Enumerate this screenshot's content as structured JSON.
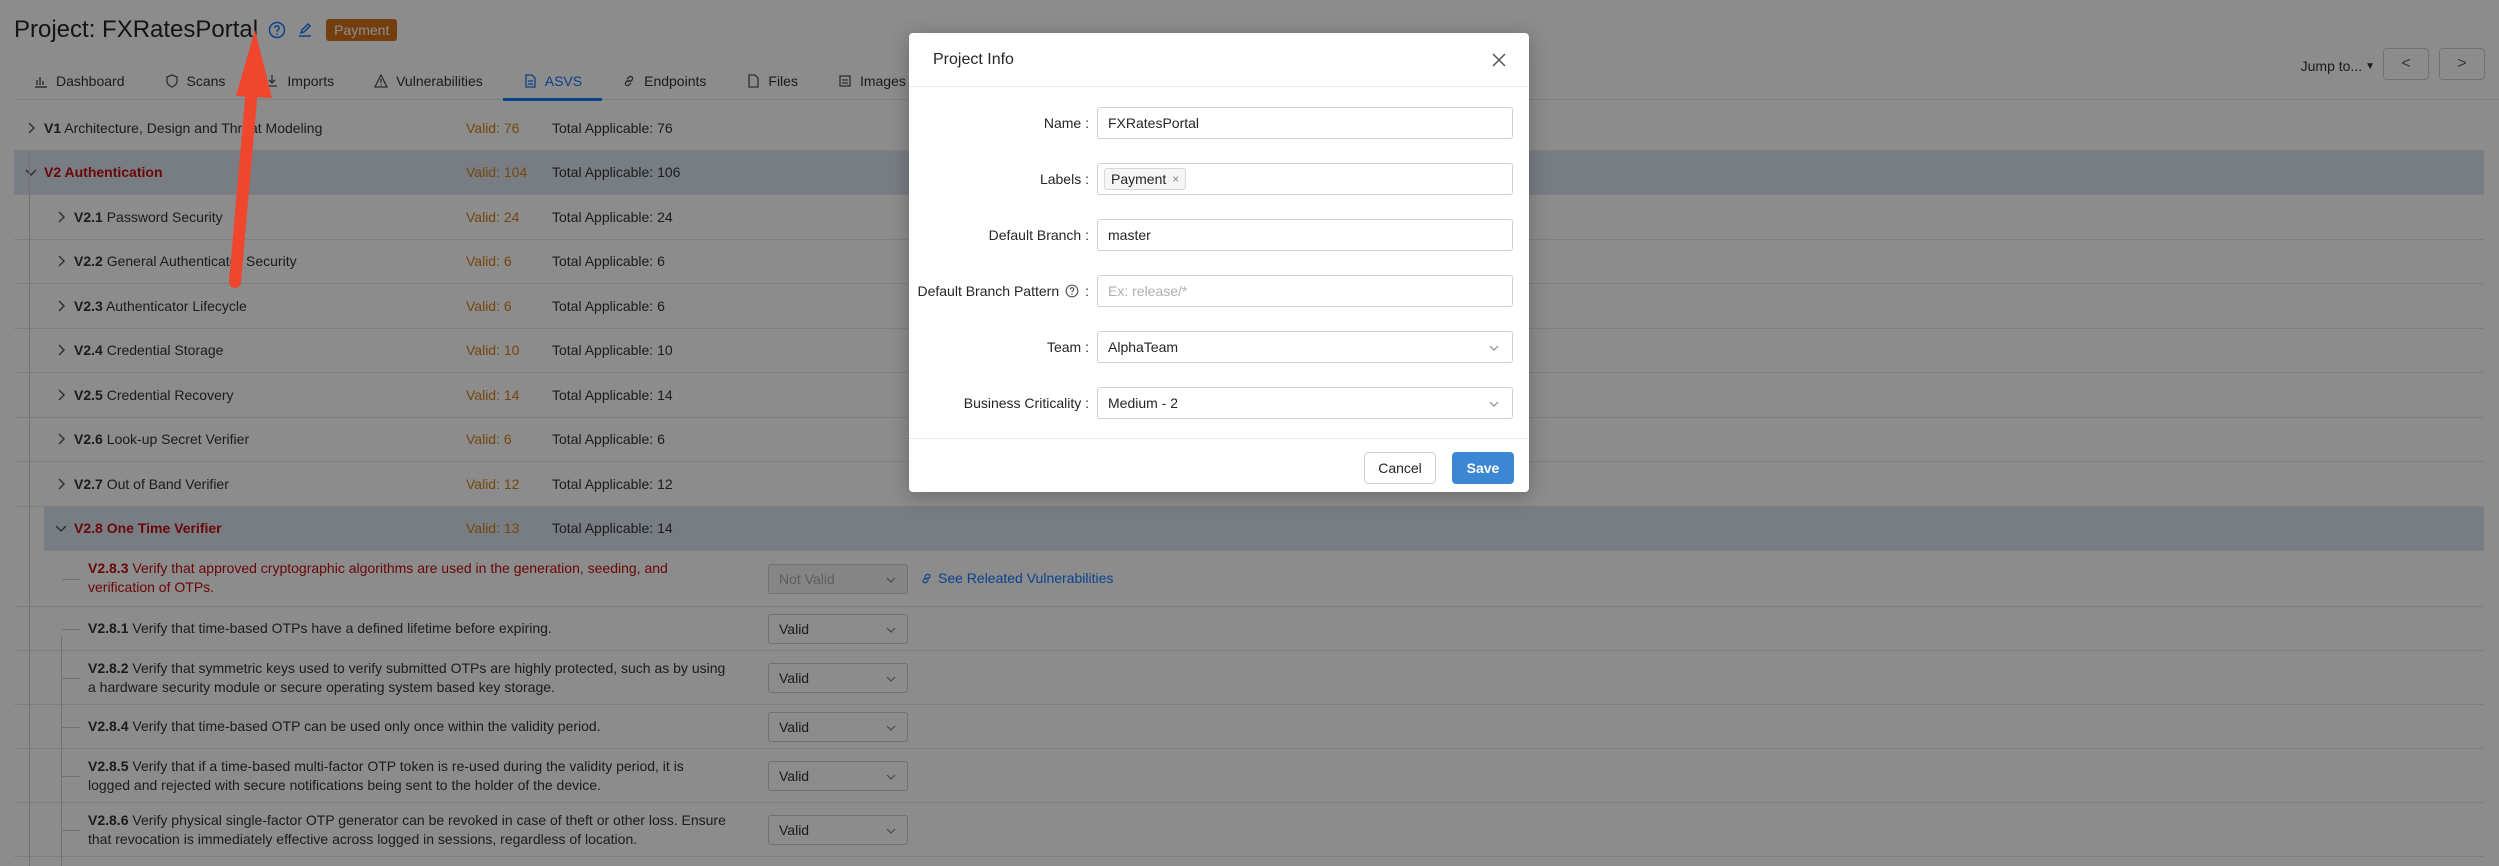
{
  "header": {
    "title": "Project: FXRatesPortal",
    "badge": "Payment"
  },
  "tabs": [
    {
      "label": "Dashboard",
      "icon": "bar-chart-icon"
    },
    {
      "label": "Scans",
      "icon": "shield-icon"
    },
    {
      "label": "Imports",
      "icon": "import-icon"
    },
    {
      "label": "Vulnerabilities",
      "icon": "warning-icon"
    },
    {
      "label": "ASVS",
      "icon": "document-icon",
      "active": true
    },
    {
      "label": "Endpoints",
      "icon": "link-icon"
    },
    {
      "label": "Files",
      "icon": "file-icon"
    },
    {
      "label": "Images",
      "icon": "image-icon"
    }
  ],
  "jump": {
    "label": "Jump to...",
    "prev": "<",
    "next": ">"
  },
  "categories": [
    {
      "code": "V1",
      "name": "Architecture, Design and Threat Modeling",
      "valid": "Valid: 76",
      "total": "Total Applicable: 76"
    },
    {
      "code": "V2",
      "name": "Authentication",
      "valid": "Valid: 104",
      "total": "Total Applicable: 106"
    },
    {
      "code": "V2.1",
      "name": "Password Security",
      "valid": "Valid: 24",
      "total": "Total Applicable: 24"
    },
    {
      "code": "V2.2",
      "name": "General Authenticator Security",
      "valid": "Valid: 6",
      "total": "Total Applicable: 6"
    },
    {
      "code": "V2.3",
      "name": "Authenticator Lifecycle",
      "valid": "Valid: 6",
      "total": "Total Applicable: 6"
    },
    {
      "code": "V2.4",
      "name": "Credential Storage",
      "valid": "Valid: 10",
      "total": "Total Applicable: 10"
    },
    {
      "code": "V2.5",
      "name": "Credential Recovery",
      "valid": "Valid: 14",
      "total": "Total Applicable: 14"
    },
    {
      "code": "V2.6",
      "name": "Look-up Secret Verifier",
      "valid": "Valid: 6",
      "total": "Total Applicable: 6"
    },
    {
      "code": "V2.7",
      "name": "Out of Band Verifier",
      "valid": "Valid: 12",
      "total": "Total Applicable: 12"
    },
    {
      "code": "V2.8",
      "name": "One Time Verifier",
      "valid": "Valid: 13",
      "total": "Total Applicable: 14"
    }
  ],
  "requirements": [
    {
      "code": "V2.8.3",
      "text": "Verify that approved cryptographic algorithms are used in the generation, seeding, and verification of OTPs.",
      "status": "Not Valid",
      "link": "See Releated Vulnerabilities"
    },
    {
      "code": "V2.8.1",
      "text": "Verify that time-based OTPs have a defined lifetime before expiring.",
      "status": "Valid"
    },
    {
      "code": "V2.8.2",
      "text": "Verify that symmetric keys used to verify submitted OTPs are highly protected, such as by using a hardware security module or secure operating system based key storage.",
      "status": "Valid"
    },
    {
      "code": "V2.8.4",
      "text": "Verify that time-based OTP can be used only once within the validity period.",
      "status": "Valid"
    },
    {
      "code": "V2.8.5",
      "text": "Verify that if a time-based multi-factor OTP token is re-used during the validity period, it is logged and rejected with secure notifications being sent to the holder of the device.",
      "status": "Valid"
    },
    {
      "code": "V2.8.6",
      "text": "Verify physical single-factor OTP generator can be revoked in case of theft or other loss. Ensure that revocation is immediately effective across logged in sessions, regardless of location.",
      "status": "Valid"
    }
  ],
  "modal": {
    "title": "Project Info",
    "fields": {
      "name": {
        "label": "Name :",
        "value": "FXRatesPortal"
      },
      "labels": {
        "label": "Labels :",
        "chip": "Payment",
        "chip_remove": "×"
      },
      "branch": {
        "label": "Default Branch :",
        "value": "master"
      },
      "pattern": {
        "label": "Default Branch Pattern",
        "suffix": ":",
        "placeholder": "Ex: release/*"
      },
      "team": {
        "label": "Team :",
        "value": "AlphaTeam"
      },
      "criticality": {
        "label": "Business Criticality :",
        "value": "Medium - 2"
      }
    },
    "cancel": "Cancel",
    "save": "Save"
  },
  "colors": {
    "accent": "#1677ff",
    "badge": "#d4711c",
    "save": "#3c87d3",
    "arrow": "#f0462e",
    "valid": "#d4811c",
    "fail": "#c10d0d"
  }
}
